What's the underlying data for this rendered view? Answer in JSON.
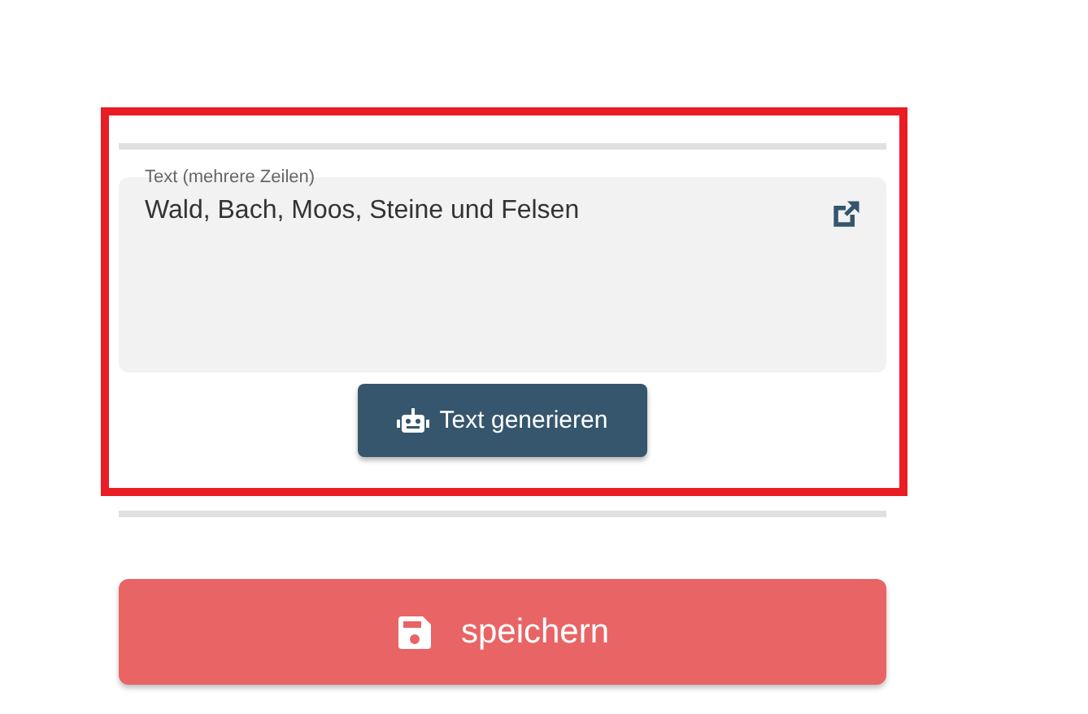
{
  "text_field": {
    "label": "Text (mehrere Zeilen)",
    "value": "Wald, Bach, Moos, Steine und Felsen"
  },
  "generate_button": {
    "label": "Text generieren"
  },
  "save_button": {
    "label": "speichern"
  }
}
